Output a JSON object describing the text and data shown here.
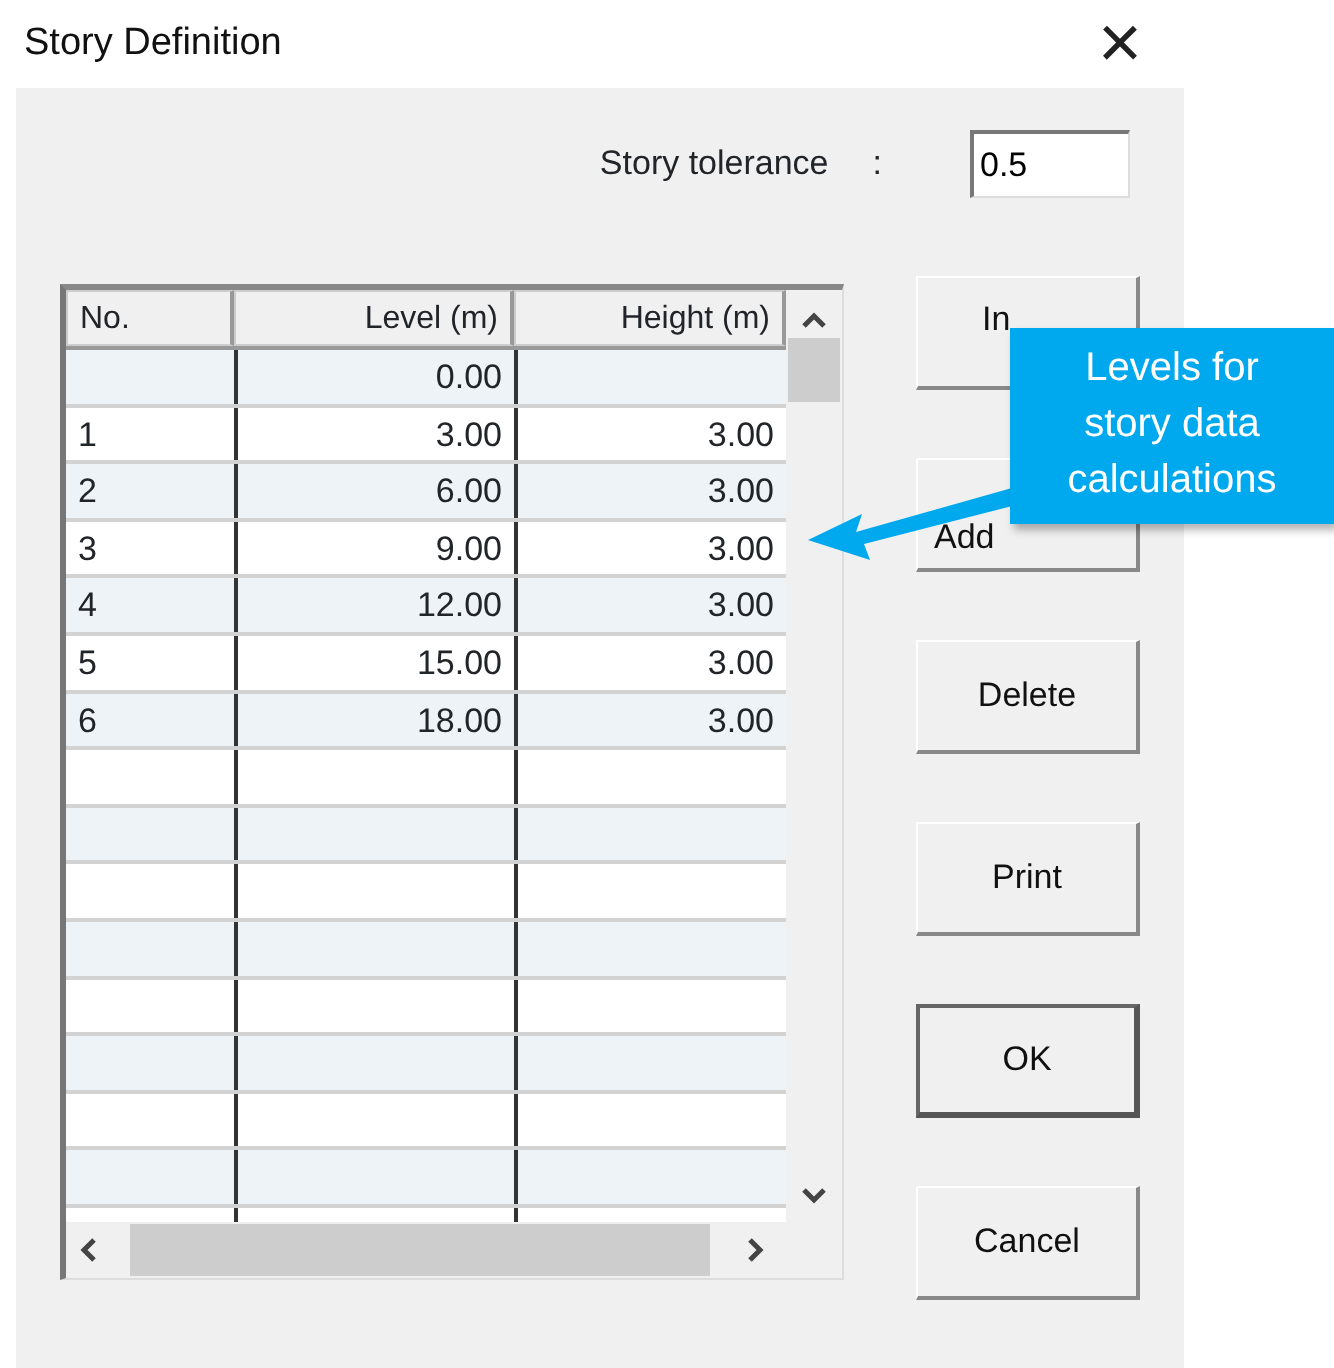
{
  "window": {
    "title": "Story Definition",
    "close": "×"
  },
  "tolerance": {
    "label": "Story tolerance",
    "separator": ":",
    "value": "0.5"
  },
  "table": {
    "columns": [
      "No.",
      "Level (m)",
      "Height (m)"
    ],
    "rows": [
      [
        "",
        "0.00",
        ""
      ],
      [
        "1",
        "3.00",
        "3.00"
      ],
      [
        "2",
        "6.00",
        "3.00"
      ],
      [
        "3",
        "9.00",
        "3.00"
      ],
      [
        "4",
        "12.00",
        "3.00"
      ],
      [
        "5",
        "15.00",
        "3.00"
      ],
      [
        "6",
        "18.00",
        "3.00"
      ]
    ]
  },
  "buttons": [
    {
      "label": "In",
      "default": false,
      "clipped": true
    },
    {
      "label": "Add",
      "default": false,
      "clipped": true
    },
    {
      "label": "Delete",
      "default": false
    },
    {
      "label": "Print",
      "default": false
    },
    {
      "label": "OK",
      "default": true
    },
    {
      "label": "Cancel",
      "default": false
    }
  ],
  "callout": {
    "text": "Levels for story data calculations"
  }
}
